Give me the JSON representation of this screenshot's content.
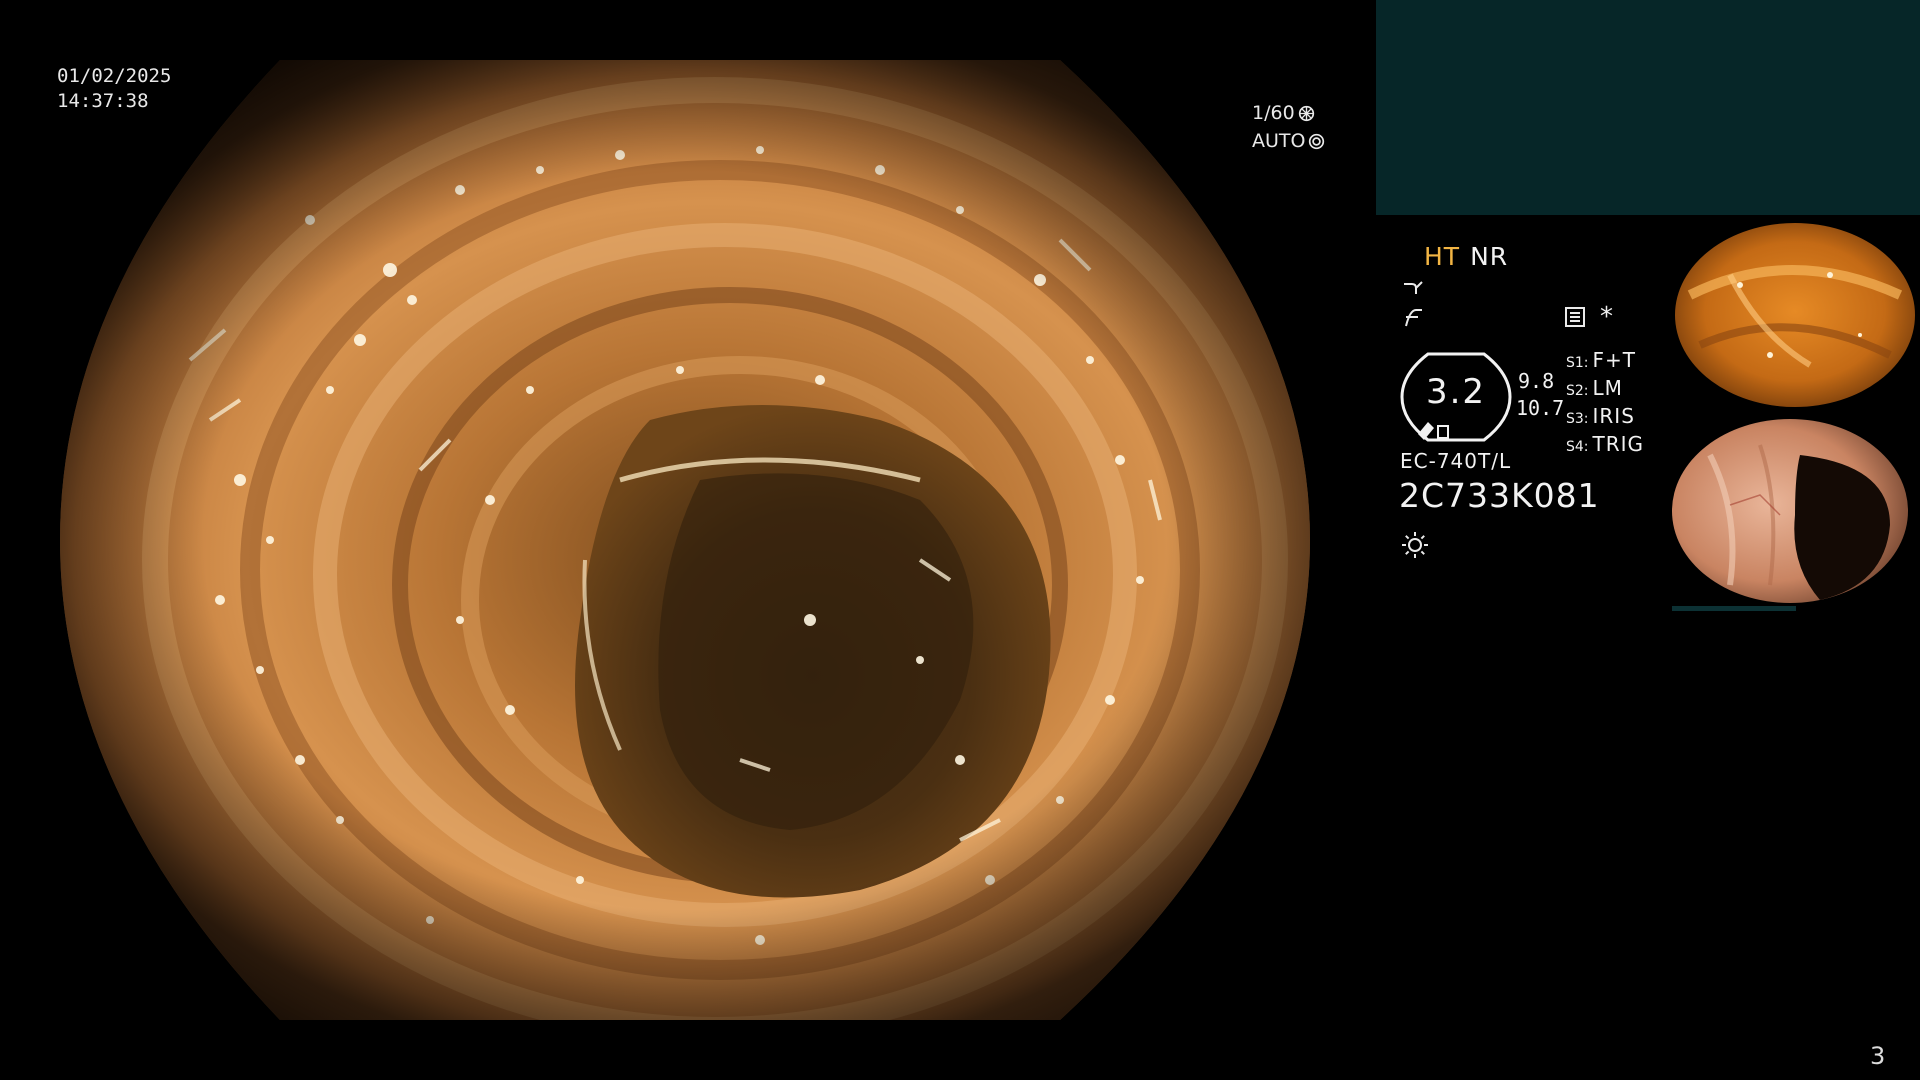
{
  "overlay": {
    "date": "01/02/2025",
    "time": "14:37:38",
    "shutter": "1/60",
    "iris": "AUTO"
  },
  "hud": {
    "mode_ht": "HT",
    "mode_nr": "NR",
    "enhance_value": "3.2",
    "side_value_1": "9.8",
    "side_value_2": "10.7",
    "switches": [
      {
        "key": "S1:",
        "value": "F+T"
      },
      {
        "key": "S2:",
        "value": "LM"
      },
      {
        "key": "S3:",
        "value": "IRIS"
      },
      {
        "key": "S4:",
        "value": "TRIG"
      }
    ],
    "scope_model": "EC-740T/L",
    "scope_serial": "2C733K081"
  },
  "page_number": "3",
  "icons": [
    "sharpness-icon",
    "contrast-icon",
    "menu-icon",
    "freeze-star-icon",
    "brightness-icon",
    "gear-icon",
    "iris-icon"
  ],
  "colors": {
    "background": "#000000",
    "accent_ht": "#f2b544",
    "panel_teal": "#062628",
    "text": "#f2f2f2"
  }
}
